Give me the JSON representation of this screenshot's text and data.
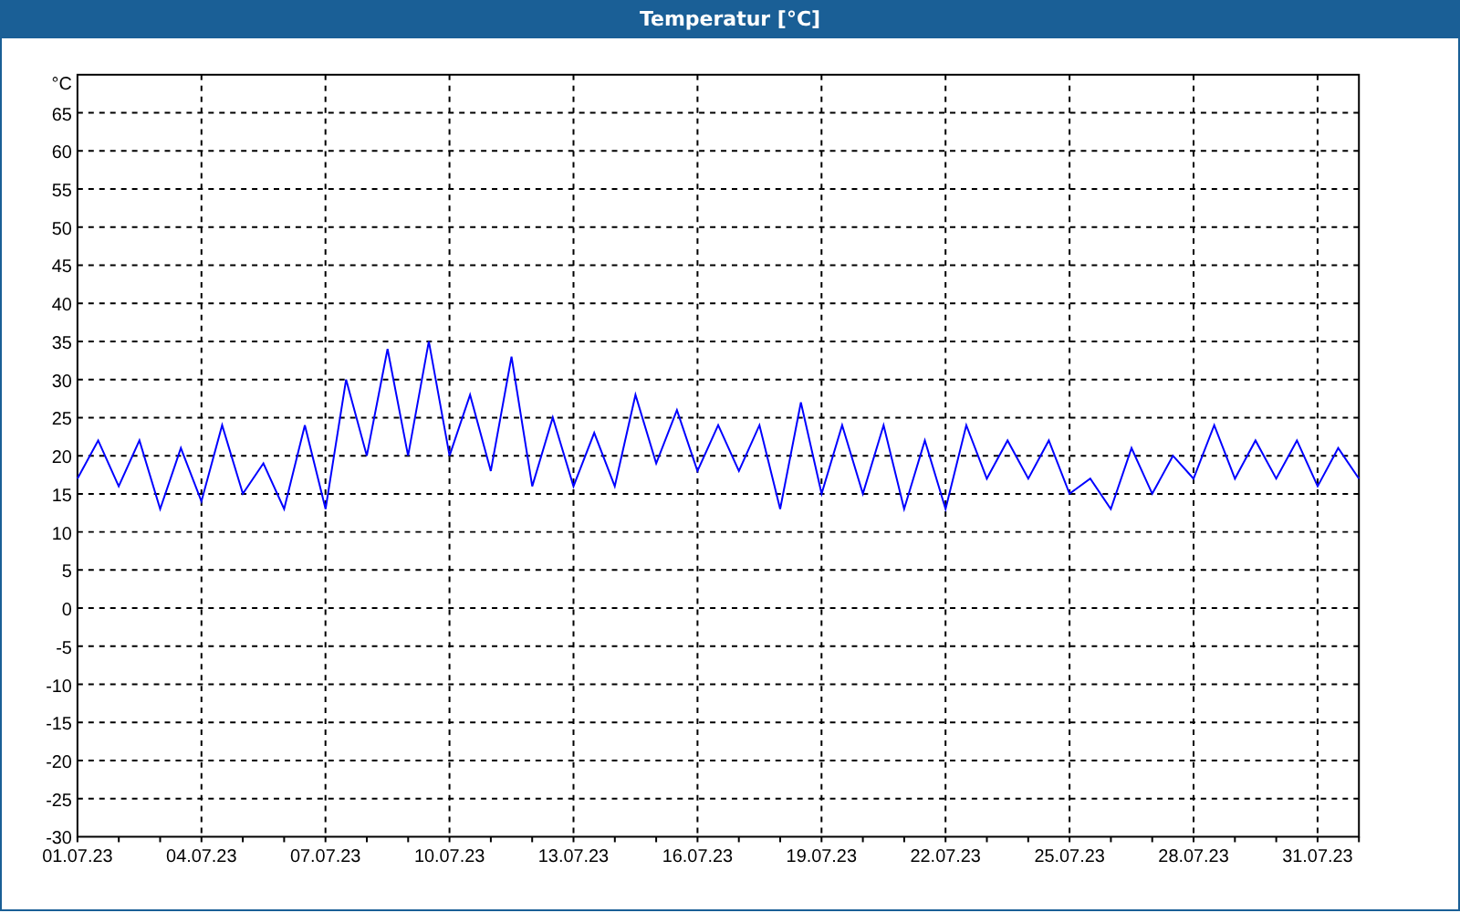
{
  "window": {
    "title": "Temperatur [°C]"
  },
  "chart_data": {
    "type": "line",
    "grid": true,
    "ylabel": "°C",
    "ylim": [
      -30,
      70
    ],
    "yticks": [
      -30,
      -25,
      -20,
      -15,
      -10,
      -5,
      0,
      5,
      10,
      15,
      20,
      25,
      30,
      35,
      40,
      45,
      50,
      55,
      60,
      65
    ],
    "categories": [
      "01.07.23",
      null,
      null,
      null,
      null,
      null,
      "04.07.23",
      null,
      null,
      null,
      null,
      null,
      "07.07.23",
      null,
      null,
      null,
      null,
      null,
      "10.07.23",
      null,
      null,
      null,
      null,
      null,
      "13.07.23",
      null,
      null,
      null,
      null,
      null,
      "16.07.23",
      null,
      null,
      null,
      null,
      null,
      "19.07.23",
      null,
      null,
      null,
      null,
      null,
      "22.07.23",
      null,
      null,
      null,
      null,
      null,
      "25.07.23",
      null,
      null,
      null,
      null,
      null,
      "28.07.23",
      null,
      null,
      null,
      null,
      null,
      "31.07.23",
      null,
      null
    ],
    "series": [
      {
        "color": "#0000ff",
        "values": [
          17,
          22,
          16,
          22,
          13,
          21,
          14,
          24,
          15,
          19,
          13,
          24,
          13,
          30,
          20,
          34,
          20,
          35,
          20,
          28,
          18,
          33,
          16,
          25,
          16,
          23,
          16,
          28,
          19,
          26,
          18,
          24,
          18,
          24,
          13,
          27,
          15,
          24,
          15,
          24,
          13,
          22,
          13,
          24,
          17,
          22,
          17,
          22,
          15,
          17,
          13,
          21,
          15,
          20,
          17,
          24,
          17,
          22,
          17,
          22,
          16,
          21,
          17
        ]
      }
    ]
  }
}
